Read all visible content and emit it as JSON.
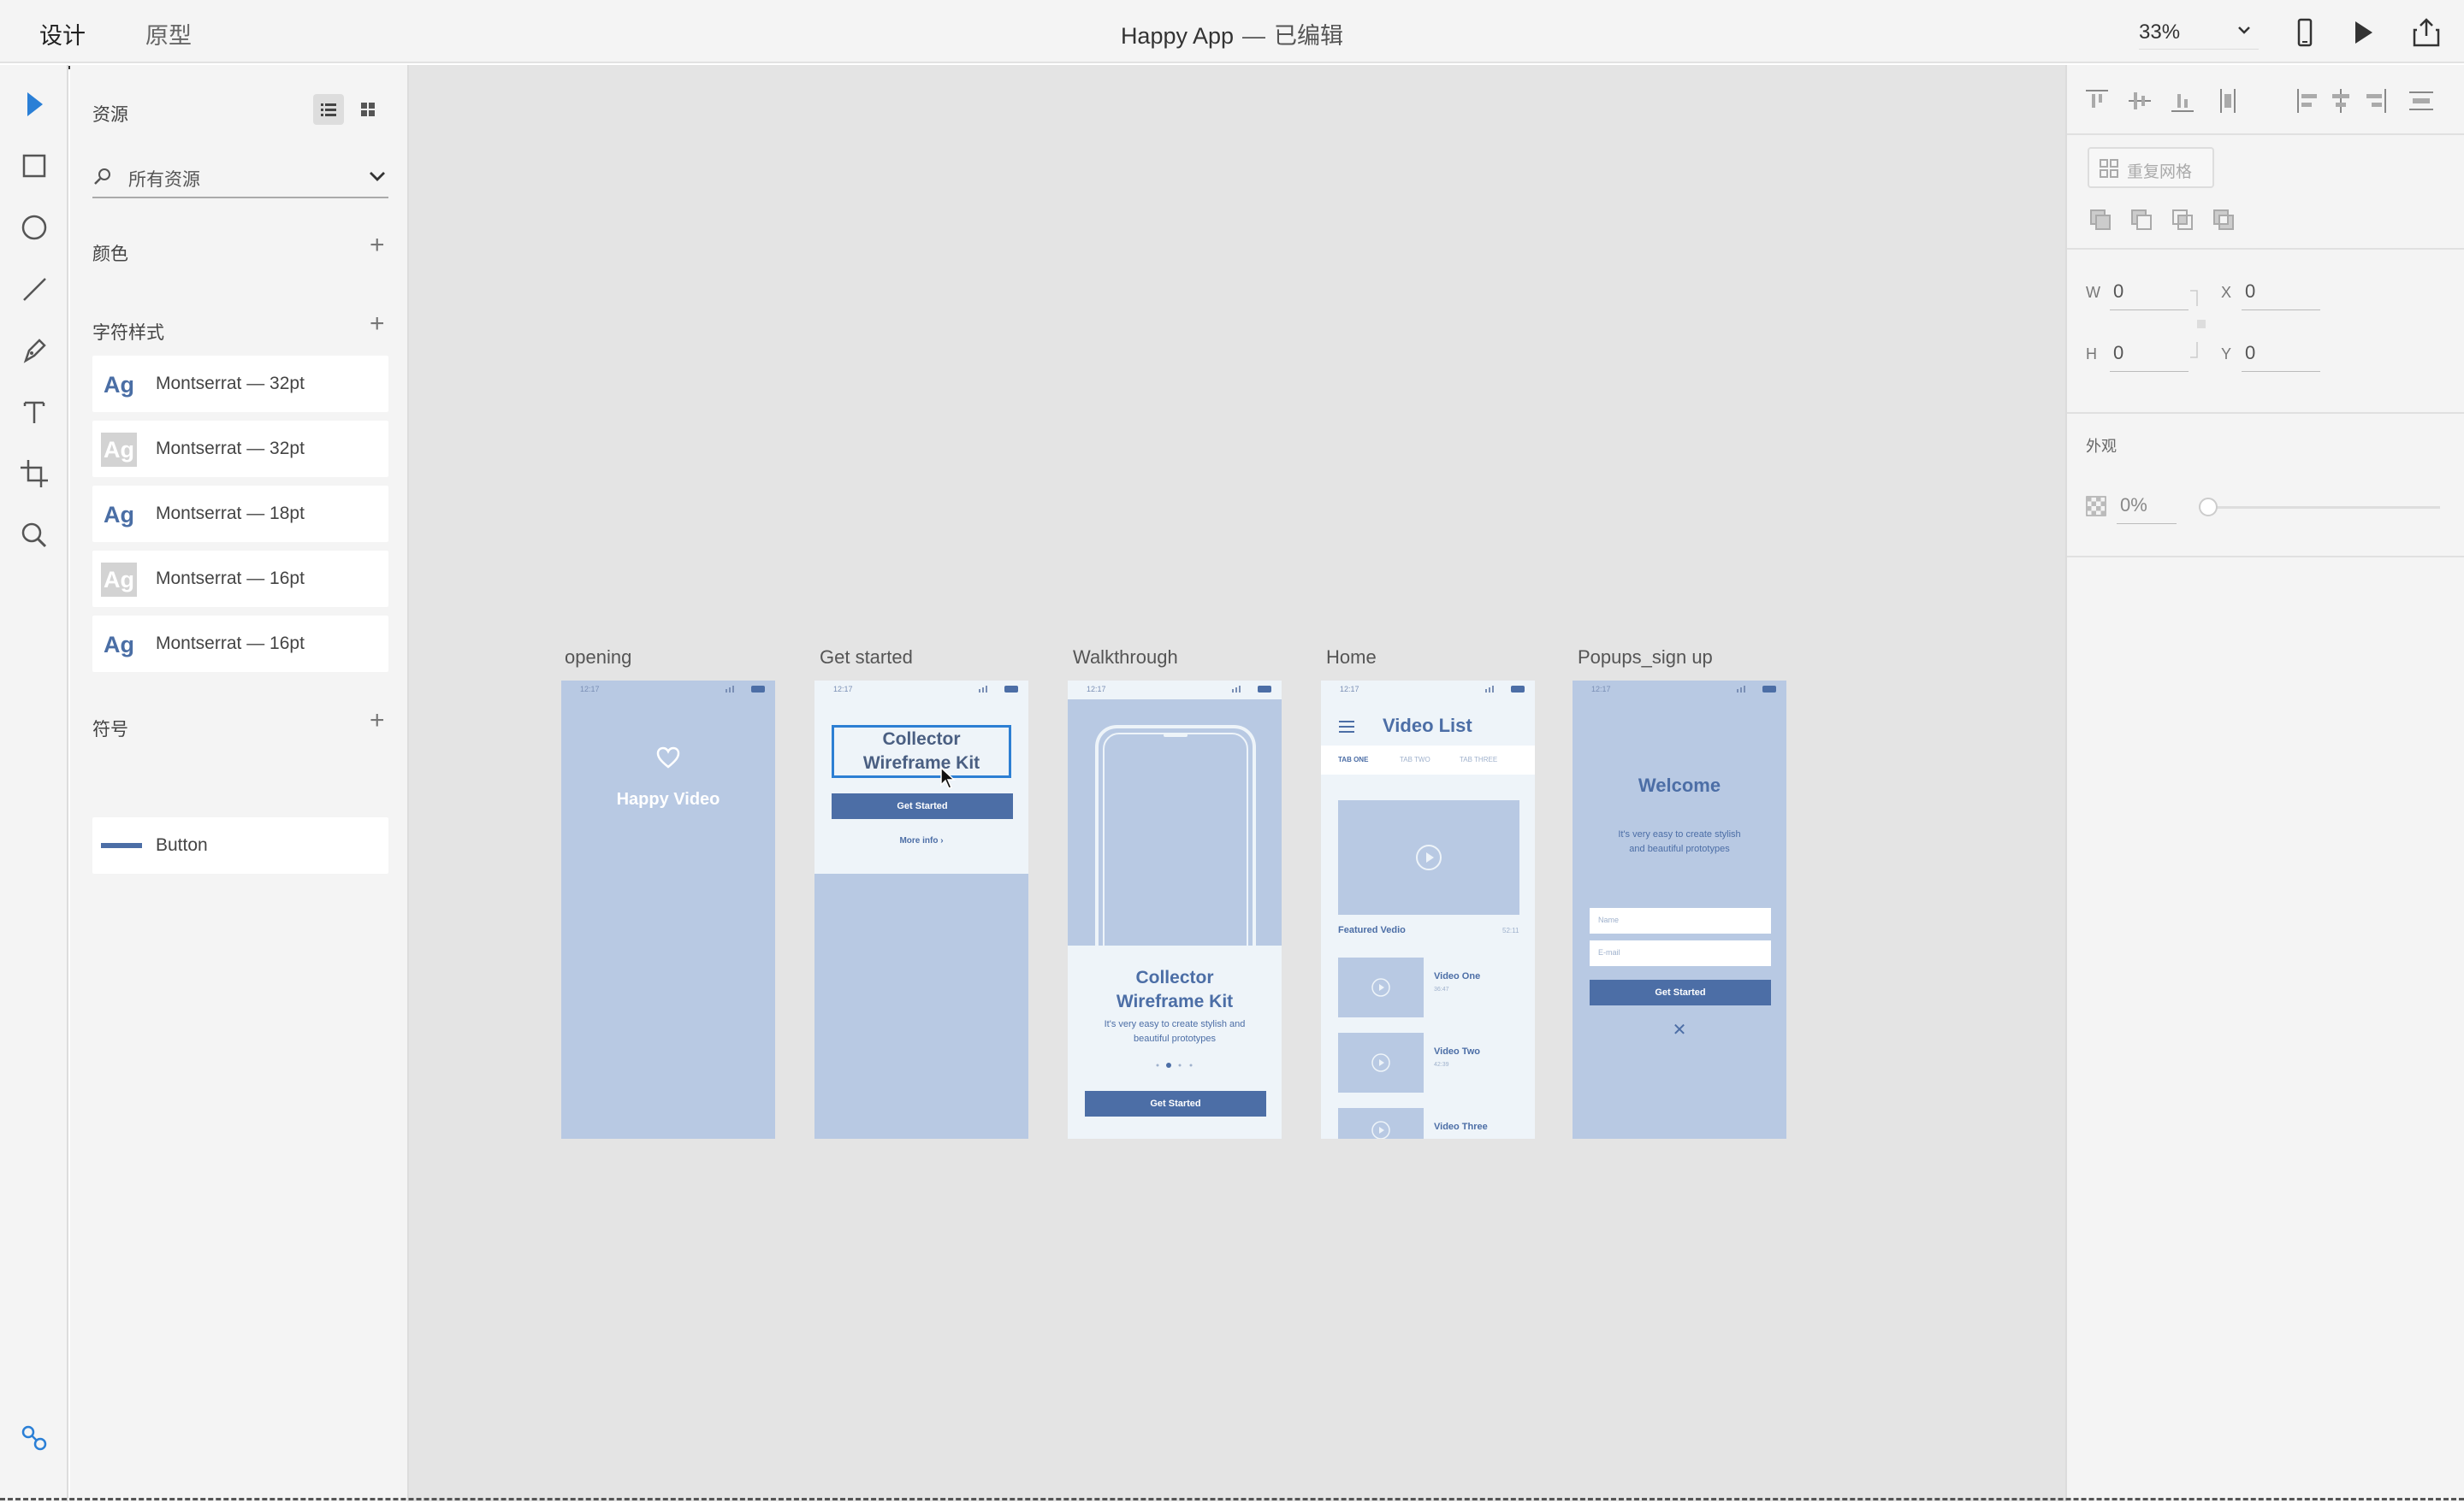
{
  "topbar": {
    "tabs": [
      {
        "label": "设计",
        "active": true
      },
      {
        "label": "原型",
        "active": false
      }
    ],
    "title": "Happy App",
    "separator": "—",
    "status": "已编辑",
    "zoom": "33%",
    "icons": [
      "device-preview-icon",
      "play-icon",
      "share-icon"
    ]
  },
  "toolbar": {
    "tools": [
      "select-icon",
      "rectangle-icon",
      "ellipse-icon",
      "line-icon",
      "pen-icon",
      "text-icon",
      "artboard-icon",
      "zoom-icon"
    ],
    "bottom_tool": "plugins-icon"
  },
  "assets": {
    "title": "资源",
    "search_placeholder": "所有资源",
    "colors_label": "颜色",
    "char_styles_label": "字符样式",
    "char_styles": [
      {
        "glyph": "Ag",
        "label": "Montserrat — 32pt",
        "inverted": false
      },
      {
        "glyph": "Ag",
        "label": "Montserrat — 32pt",
        "inverted": true
      },
      {
        "glyph": "Ag",
        "label": "Montserrat — 18pt",
        "inverted": false
      },
      {
        "glyph": "Ag",
        "label": "Montserrat — 16pt",
        "inverted": true
      },
      {
        "glyph": "Ag",
        "label": "Montserrat — 16pt",
        "inverted": false
      }
    ],
    "symbols_label": "符号",
    "symbols": [
      {
        "label": "Button"
      }
    ]
  },
  "canvas": {
    "artboards": [
      {
        "name": "opening"
      },
      {
        "name": "Get started"
      },
      {
        "name": "Walkthrough"
      },
      {
        "name": "Home"
      },
      {
        "name": "Popups_sign up"
      }
    ],
    "status_time": "12:17",
    "opening": {
      "title": "Happy Video"
    },
    "get_started": {
      "heading_line1": "Collector",
      "heading_line2": "Wireframe Kit",
      "button": "Get Started",
      "link": "More info"
    },
    "walkthrough": {
      "heading_line1": "Collector",
      "heading_line2": "Wireframe Kit",
      "body_line1": "It's very easy to create stylish and",
      "body_line2": "beautiful prototypes",
      "button": "Get Started"
    },
    "home": {
      "title": "Video List",
      "tabs": [
        "TAB ONE",
        "TAB TWO",
        "TAB THREE"
      ],
      "featured": "Featured Vedio",
      "featured_time": "52:11",
      "videos": [
        {
          "title": "Video One",
          "time": "36:47"
        },
        {
          "title": "Video Two",
          "time": "42:39"
        },
        {
          "title": "Video Three",
          "time": ""
        }
      ]
    },
    "popup": {
      "title": "Welcome",
      "body_line1": "It's very easy to create stylish",
      "body_line2": "and beautiful prototypes",
      "name_placeholder": "Name",
      "email_placeholder": "E-mail",
      "button": "Get Started",
      "close": "✕"
    }
  },
  "properties": {
    "repeat_grid": "重复网格",
    "w_label": "W",
    "w_value": "0",
    "h_label": "H",
    "h_value": "0",
    "x_label": "X",
    "x_value": "0",
    "y_label": "Y",
    "y_value": "0",
    "appearance_label": "外观",
    "opacity": "0%",
    "opacity_level": 0
  }
}
